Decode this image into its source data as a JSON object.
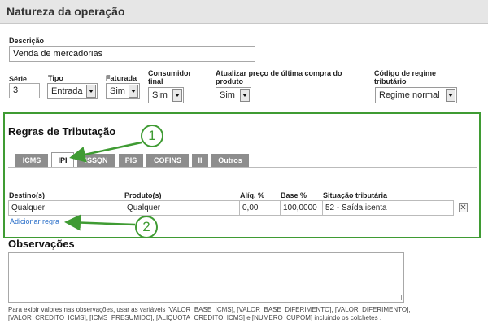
{
  "header": {
    "title": "Natureza da operação"
  },
  "descricao": {
    "label": "Descrição",
    "value": "Venda de mercadorias"
  },
  "serie": {
    "label": "Série",
    "value": "3"
  },
  "tipo": {
    "label": "Tipo",
    "value": "Entrada"
  },
  "faturada": {
    "label": "Faturada",
    "value": "Sim"
  },
  "consumidor": {
    "label_line1": "Consumidor",
    "label_line2": "final",
    "value": "Sim"
  },
  "atualizar": {
    "label_line1": "Atualizar preço de última compra do",
    "label_line2": "produto",
    "value": "Sim"
  },
  "regime": {
    "label_line1": "Código de regime",
    "label_line2": "tributário",
    "value": "Regime normal"
  },
  "regras": {
    "title": "Regras de Tributação",
    "tabs": [
      "ICMS",
      "IPI",
      "ISSQN",
      "PIS",
      "COFINS",
      "II",
      "Outros"
    ],
    "active_tab": "IPI",
    "columns": [
      "Destino(s)",
      "Produto(s)",
      "Alíq. %",
      "Base %",
      "Situação tributária"
    ],
    "rows": [
      {
        "destino": "Qualquer",
        "produto": "Qualquer",
        "aliq": "0,00",
        "base": "100,0000",
        "situacao": "52 - Saída isenta"
      }
    ],
    "delete_glyph": "✕",
    "add_link": "Adicionar regra"
  },
  "observacoes": {
    "title": "Observações",
    "value": "",
    "help": "Para exibir valores nas observações, usar as variáveis [VALOR_BASE_ICMS], [VALOR_BASE_DIFERIMENTO], [VALOR_DIFERIMENTO], [VALOR_CREDITO_ICMS], [ICMS_PRESUMIDO], [ALIQUOTA_CREDITO_ICMS] e [NUMERO_CUPOM] incluindo os colchetes ."
  },
  "callouts": [
    "1",
    "2"
  ],
  "colors": {
    "highlight_green": "#3f9b33",
    "tab_gray": "#8d8d8d",
    "link_blue": "#2a6fc9",
    "header_bg": "#e6e6e6"
  },
  "icons": {
    "select_arrow": "chevron-down-icon",
    "delete": "close-icon"
  }
}
